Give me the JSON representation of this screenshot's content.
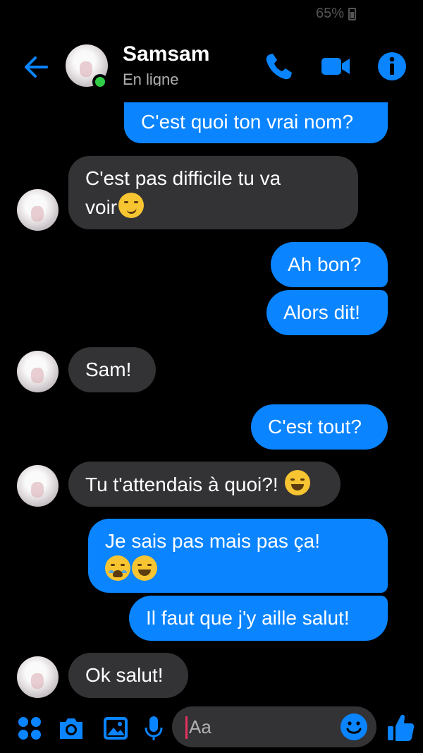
{
  "status_bar": {
    "battery_text": "65%"
  },
  "header": {
    "contact_name": "Samsam",
    "contact_status": "En ligne",
    "colors": {
      "accent": "#0a84ff",
      "online": "#31cc46"
    },
    "icons": [
      "back-arrow-icon",
      "phone-icon",
      "video-icon",
      "info-icon"
    ]
  },
  "messages": [
    {
      "direction": "out",
      "text": "C'est quoi ton vrai nom?"
    },
    {
      "direction": "in",
      "line1": "C'est pas difficile tu va",
      "line2": "voir",
      "emoji": "smirking-face-emoji"
    },
    {
      "direction": "out",
      "text": "Ah bon?"
    },
    {
      "direction": "out",
      "text": "Alors dit!"
    },
    {
      "direction": "in",
      "text": "Sam!"
    },
    {
      "direction": "out",
      "text": "C'est tout?"
    },
    {
      "direction": "in",
      "text": "Tu t'attendais à quoi?! ",
      "emoji": "rolling-laughing-emoji"
    },
    {
      "direction": "out",
      "text": "Je sais pas mais pas ça!",
      "emojis": [
        "loudly-crying-emoji",
        "rolling-laughing-emoji"
      ]
    },
    {
      "direction": "out",
      "text": "Il faut que j'y aille salut!"
    },
    {
      "direction": "in",
      "text": "Ok salut!"
    }
  ],
  "composer": {
    "placeholder": "Aa",
    "icons": [
      "apps-grid-icon",
      "camera-icon",
      "gallery-icon",
      "microphone-icon",
      "emoji-icon",
      "thumbs-up-icon"
    ]
  }
}
